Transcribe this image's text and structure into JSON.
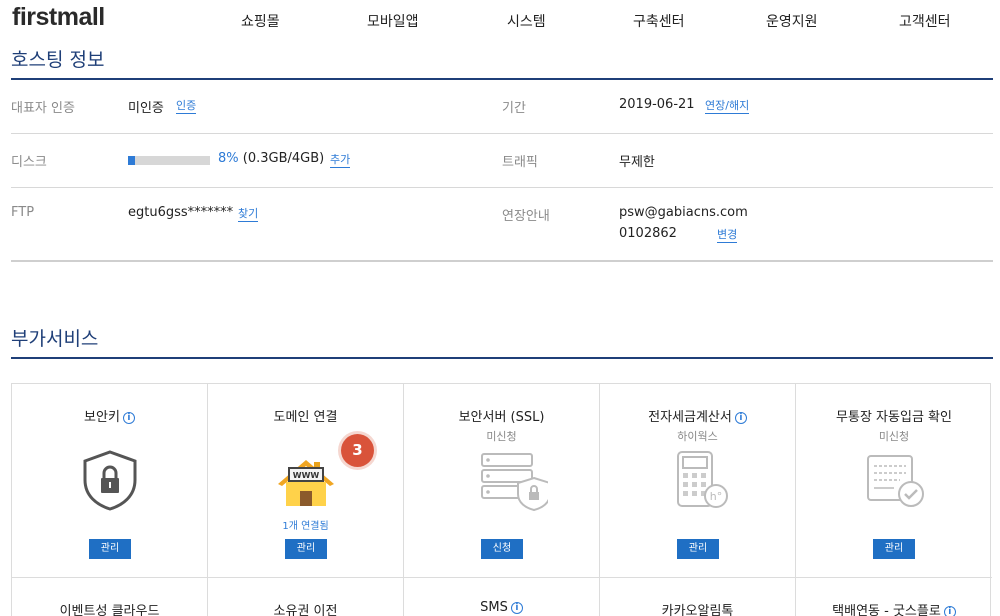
{
  "nav": {
    "logo": "firstmall",
    "items": [
      "쇼핑몰",
      "모바일앱",
      "시스템",
      "구축센터",
      "운영지원",
      "고객센터"
    ]
  },
  "hosting": {
    "title": "호스팅 정보",
    "owner_auth_label": "대표자 인증",
    "owner_auth_value": "미인증",
    "owner_auth_link": "인증",
    "period_label": "기간",
    "period_value": "2019-06-21",
    "period_link": "연장/해지",
    "disk_label": "디스크",
    "disk_percent_text": "8%",
    "disk_usage": "(0.3GB/4GB)",
    "disk_fraction": 0.08,
    "disk_link": "추가",
    "traffic_label": "트래픽",
    "traffic_value": "무제한",
    "ftp_label": "FTP",
    "ftp_value": "egtu6gss*******",
    "ftp_link": "찾기",
    "renew_label": "연장안내",
    "renew_email": "psw@gabiacns.com",
    "renew_phone": "0102862",
    "renew_link": "변경"
  },
  "services": {
    "title": "부가서비스",
    "badge": "3",
    "row1": [
      {
        "title": "보안키",
        "info": "i",
        "sub": "",
        "note": "",
        "button": "관리",
        "icon": "shield-lock-icon"
      },
      {
        "title": "도메인 연결",
        "info": "",
        "sub": "",
        "note": "1개 연결됨",
        "button": "관리",
        "icon": "www-house-icon"
      },
      {
        "title": "보안서버 (SSL)",
        "info": "",
        "sub": "미신청",
        "note": "",
        "button": "신청",
        "icon": "server-lock-icon"
      },
      {
        "title": "전자세금계산서",
        "info": "i",
        "sub": "하이웍스",
        "note": "",
        "button": "관리",
        "icon": "calculator-icon"
      },
      {
        "title": "무통장 자동입금 확인",
        "info": "",
        "sub": "미신청",
        "note": "",
        "button": "관리",
        "icon": "bankbook-check-icon"
      }
    ],
    "row2": [
      {
        "title": "이벤트성 클라우드",
        "info": ""
      },
      {
        "title": "소유권 이전",
        "info": ""
      },
      {
        "title": "SMS",
        "info": "i"
      },
      {
        "title": "카카오알림톡",
        "info": ""
      },
      {
        "title": "택배연동 - 굿스플로",
        "info": "i"
      }
    ]
  }
}
